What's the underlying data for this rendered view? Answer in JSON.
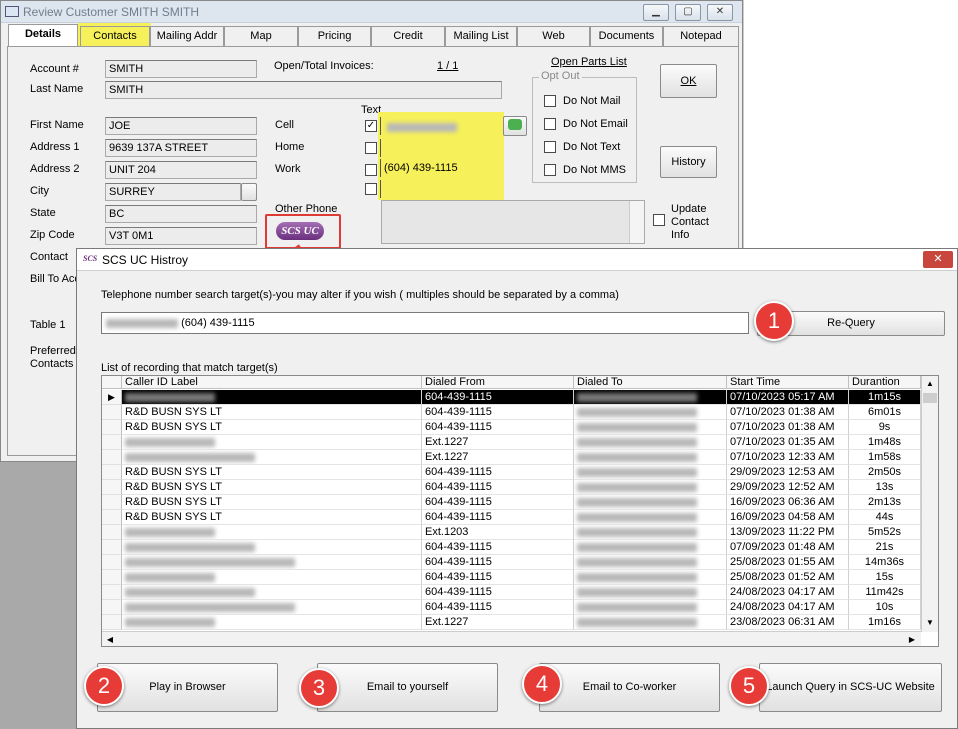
{
  "review": {
    "title": "Review Customer SMITH SMITH",
    "tabs": [
      "Details",
      "Contacts",
      "Mailing Addr",
      "Map",
      "Pricing",
      "Credit",
      "Mailing List",
      "Web",
      "Documents",
      "Notepad"
    ],
    "labels": {
      "account": "Account #",
      "lastname": "Last Name",
      "firstname": "First Name",
      "address1": "Address 1",
      "address2": "Address 2",
      "city": "City",
      "state": "State",
      "zip": "Zip Code",
      "contact": "Contact",
      "billto": "Bill To Acc",
      "table1": "Table 1",
      "preferred": "Preferred Contacts",
      "invoices": "Open/Total Invoices:",
      "text": "Text",
      "cell": "Cell",
      "home": "Home",
      "work": "Work",
      "otherphone": "Other Phone",
      "openparts": "Open Parts List",
      "optout": "Opt Out",
      "update": "Update Contact Info"
    },
    "values": {
      "account": "SMITH",
      "lastname": "SMITH",
      "firstname": "JOE",
      "address1": "9639 137A STREET",
      "address2": "UNIT 204",
      "city": "SURREY",
      "state": "BC",
      "zip": "V3T 0M1",
      "invoices": "1 / 1",
      "work": "(604) 439-1115"
    },
    "optout": [
      "Do Not Mail",
      "Do Not Email",
      "Do Not Text",
      "Do Not MMS"
    ],
    "buttons": {
      "ok": "OK",
      "history": "History",
      "scs": "SCS UC"
    }
  },
  "dialog": {
    "title": "SCS UC Histroy",
    "logo": "SCS",
    "close": "✕",
    "prompt": "Telephone number search target(s)-you may alter if you wish ( multiples should be separated by a comma)",
    "query_value": "(604) 439-1115",
    "requery": "Re-Query",
    "list_label": "List of recording that match target(s)",
    "columns": [
      "Caller ID Label",
      "Dialed From",
      "Dialed To",
      "Start Time",
      "Durantion"
    ],
    "rows": [
      {
        "caller": "",
        "from": "604-439-1115",
        "start": "07/10/2023 05:17 AM",
        "dur": "1m15s"
      },
      {
        "caller": "R&D BUSN SYS LT",
        "from": "604-439-1115",
        "start": "07/10/2023 01:38 AM",
        "dur": "6m01s"
      },
      {
        "caller": "R&D BUSN SYS LT",
        "from": "604-439-1115",
        "start": "07/10/2023 01:38 AM",
        "dur": "9s"
      },
      {
        "caller": "",
        "from": "Ext.1227",
        "start": "07/10/2023 01:35 AM",
        "dur": "1m48s"
      },
      {
        "caller": "",
        "from": "Ext.1227",
        "start": "07/10/2023 12:33 AM",
        "dur": "1m58s"
      },
      {
        "caller": "R&D BUSN SYS LT",
        "from": "604-439-1115",
        "start": "29/09/2023 12:53 AM",
        "dur": "2m50s"
      },
      {
        "caller": "R&D BUSN SYS LT",
        "from": "604-439-1115",
        "start": "29/09/2023 12:52 AM",
        "dur": "13s"
      },
      {
        "caller": "R&D BUSN SYS LT",
        "from": "604-439-1115",
        "start": "16/09/2023 06:36 AM",
        "dur": "2m13s"
      },
      {
        "caller": "R&D BUSN SYS LT",
        "from": "604-439-1115",
        "start": "16/09/2023 04:58 AM",
        "dur": "44s"
      },
      {
        "caller": "",
        "from": "Ext.1203",
        "start": "13/09/2023 11:22 PM",
        "dur": "5m52s"
      },
      {
        "caller": "",
        "from": "604-439-1115",
        "start": "07/09/2023 01:48 AM",
        "dur": "21s"
      },
      {
        "caller": "",
        "from": "604-439-1115",
        "start": "25/08/2023 01:55 AM",
        "dur": "14m36s"
      },
      {
        "caller": "",
        "from": "604-439-1115",
        "start": "25/08/2023 01:52 AM",
        "dur": "15s"
      },
      {
        "caller": "",
        "from": "604-439-1115",
        "start": "24/08/2023 04:17 AM",
        "dur": "11m42s"
      },
      {
        "caller": "",
        "from": "604-439-1115",
        "start": "24/08/2023 04:17 AM",
        "dur": "10s"
      },
      {
        "caller": "",
        "from": "Ext.1227",
        "start": "23/08/2023 06:31 AM",
        "dur": "1m16s"
      }
    ],
    "actions": [
      "Play in Browser",
      "Email to yourself",
      "Email to Co-worker",
      "Launch Query in SCS-UC Website"
    ]
  },
  "callouts": [
    "1",
    "2",
    "3",
    "4",
    "5"
  ]
}
